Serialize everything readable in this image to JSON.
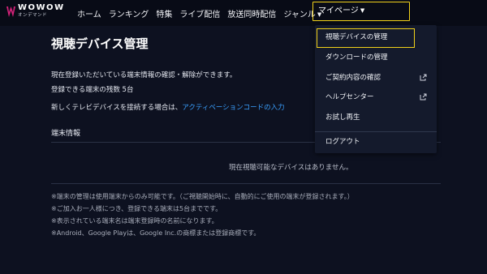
{
  "brand": {
    "name": "WOWOW",
    "sub": "オンデマンド"
  },
  "nav": {
    "items": [
      "ホーム",
      "ランキング",
      "特集",
      "ライブ配信",
      "放送同時配信",
      "ジャンル"
    ],
    "mypage": "マイページ"
  },
  "page": {
    "title": "視聴デバイス管理",
    "desc1": "現在登録いただいている端末情報の確認・解除ができます。",
    "remaining_label": "登録できる端末の残数",
    "remaining_value": "5台",
    "connect_prefix": "新しくテレビデバイスを接続する場合は、",
    "connect_link": "アクティベーションコードの入力",
    "section_label": "端末情報",
    "empty_message": "現在視聴可能なデバイスはありません。",
    "notes": [
      "※端末の管理は使用端末からのみ可能です。（ご視聴開始時に、自動的にご使用の端末が登録されます。）",
      "※ご加入お一人様につき、登録できる端末は5台までです。",
      "※表示されている端末名は端末登録時の名前になります。",
      "※Android、Google Playは、Google Inc.の商標または登録商標です。"
    ]
  },
  "dropdown": {
    "items": [
      {
        "label": "視聴デバイスの管理",
        "active": true,
        "external": false
      },
      {
        "label": "ダウンロードの管理",
        "active": false,
        "external": false
      },
      {
        "label": "ご契約内容の確認",
        "active": false,
        "external": true
      },
      {
        "label": "ヘルプセンター",
        "active": false,
        "external": true
      },
      {
        "label": "お試し再生",
        "active": false,
        "external": false
      },
      {
        "label": "ログアウト",
        "active": false,
        "external": false
      }
    ]
  },
  "colors": {
    "accent": "#f2d21a",
    "link": "#3aa0ff",
    "background": "#0d1120",
    "logo": "#d6227a"
  }
}
